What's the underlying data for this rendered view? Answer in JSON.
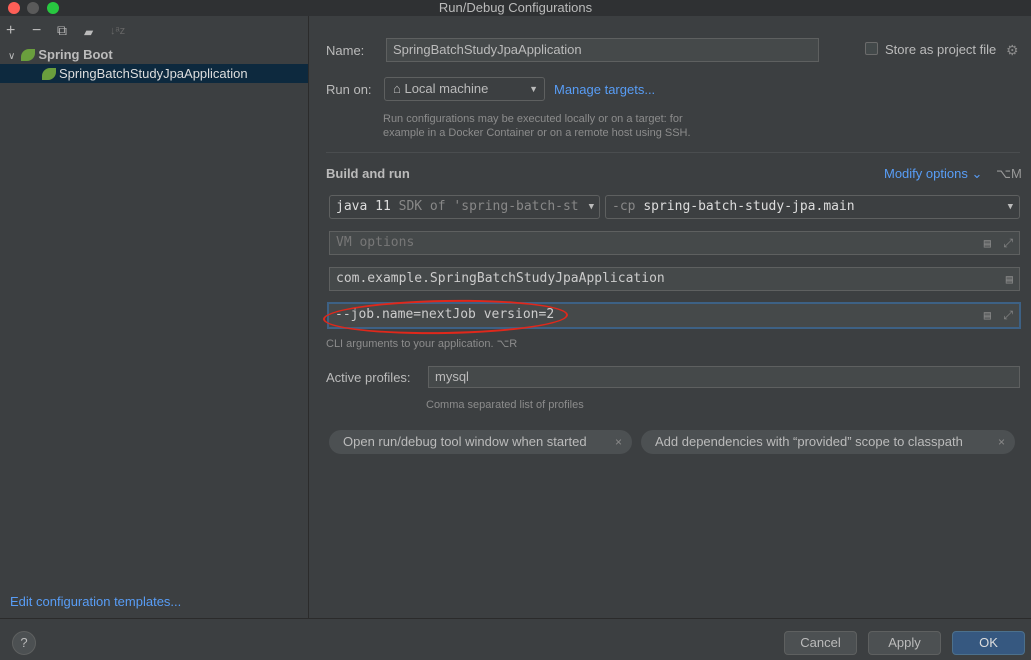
{
  "window": {
    "title": "Run/Debug Configurations"
  },
  "toolbar": {
    "add": "+",
    "remove": "−",
    "copy": "⧉",
    "folder": "▰",
    "sort": "↓ᵃz"
  },
  "tree": {
    "group": "Spring Boot",
    "item": "SpringBatchStudyJpaApplication"
  },
  "left_footer": {
    "edit_templates": "Edit configuration templates..."
  },
  "form": {
    "name_label": "Name:",
    "name_value": "SpringBatchStudyJpaApplication",
    "store_label": "Store as project file",
    "store_checked": false,
    "run_on_label": "Run on:",
    "run_on_value": "Local machine",
    "manage_targets": "Manage targets...",
    "run_on_hint_1": "Run configurations may be executed locally or on a target: for",
    "run_on_hint_2": "example in a Docker Container or on a remote host using SSH.",
    "section": "Build and run",
    "modify_options": "Modify options",
    "modify_shortcut": "⌥M",
    "jdk_main": "java 11",
    "jdk_sub": "SDK of 'spring-batch-st",
    "cp_prefix": "-cp",
    "cp_value": "spring-batch-study-jpa.main",
    "vm_placeholder": "VM options",
    "main_class": "com.example.SpringBatchStudyJpaApplication",
    "program_args": "--job.name=nextJob version=2",
    "cli_hint": "CLI arguments to your application. ⌥R",
    "profiles_label": "Active profiles:",
    "profiles_value": "mysql",
    "profiles_hint": "Comma separated list of profiles",
    "chips": [
      "Open run/debug tool window when started",
      "Add dependencies with “provided” scope to classpath"
    ]
  },
  "footer": {
    "help": "?",
    "cancel": "Cancel",
    "apply": "Apply",
    "ok": "OK"
  },
  "colors": {
    "accent": "#589df6",
    "ok": "#365880",
    "annotation": "#e0281b"
  }
}
